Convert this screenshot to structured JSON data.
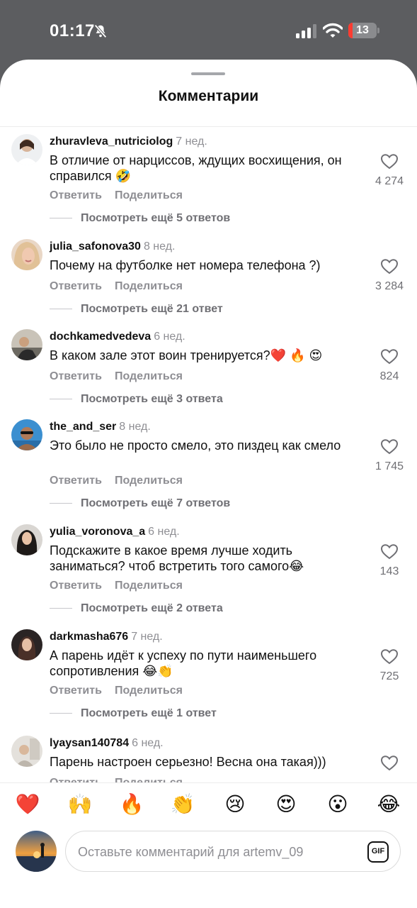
{
  "status_bar": {
    "time": "01:17",
    "battery": "13",
    "mute_icon": "bell-slash-icon",
    "signal_icon": "cellular-signal-icon",
    "wifi_icon": "wifi-icon"
  },
  "sheet": {
    "title": "Комментарии"
  },
  "actions": {
    "reply": "Ответить",
    "share": "Поделиться"
  },
  "comments": [
    {
      "username": "zhuravleva_nutriciolog",
      "age": "7 нед.",
      "text": "В отличие от нарциссов, ждущих восхищения, он справился 🤣",
      "likes": "4 274",
      "replies": "Посмотреть ещё 5 ответов"
    },
    {
      "username": "julia_safonova30",
      "age": "8 нед.",
      "text": "Почему на футболке нет номера телефона ?)",
      "likes": "3 284",
      "replies": "Посмотреть ещё 21 ответ"
    },
    {
      "username": "dochkamedvedeva",
      "age": "6 нед.",
      "text": "В каком зале этот воин тренируется?❤️ 🔥 😍",
      "likes": "824",
      "replies": "Посмотреть ещё 3 ответа"
    },
    {
      "username": "the_and_ser",
      "age": "8 нед.",
      "text": "Это было не просто смело, это пиздец как смело",
      "likes": "1 745",
      "replies": "Посмотреть ещё 7 ответов"
    },
    {
      "username": "yulia_voronova_a",
      "age": "6 нед.",
      "text": "Подскажите в какое время лучше ходить заниматься? чтоб встретить того самого😂",
      "likes": "143",
      "replies": "Посмотреть ещё 2 ответа"
    },
    {
      "username": "darkmasha676",
      "age": "7 нед.",
      "text": "А парень идёт к успеху по пути наименьшего сопротивления 😂👏",
      "likes": "725",
      "replies": "Посмотреть ещё 1 ответ"
    },
    {
      "username": "lyaysan140784",
      "age": "6 нед.",
      "text": "Парень настроен серьезно! Весна она такая)))",
      "likes": "",
      "replies": ""
    }
  ],
  "reactions": [
    "❤️",
    "🙌",
    "🔥",
    "👏",
    "😢",
    "😍",
    "😮",
    "😂"
  ],
  "composer": {
    "placeholder": "Оставьте комментарий для artemv_09",
    "gif_label": "GIF"
  },
  "colors": {
    "accent_text": "#111111",
    "muted_text": "#8e8e93",
    "battery_low": "#ff3b30"
  }
}
